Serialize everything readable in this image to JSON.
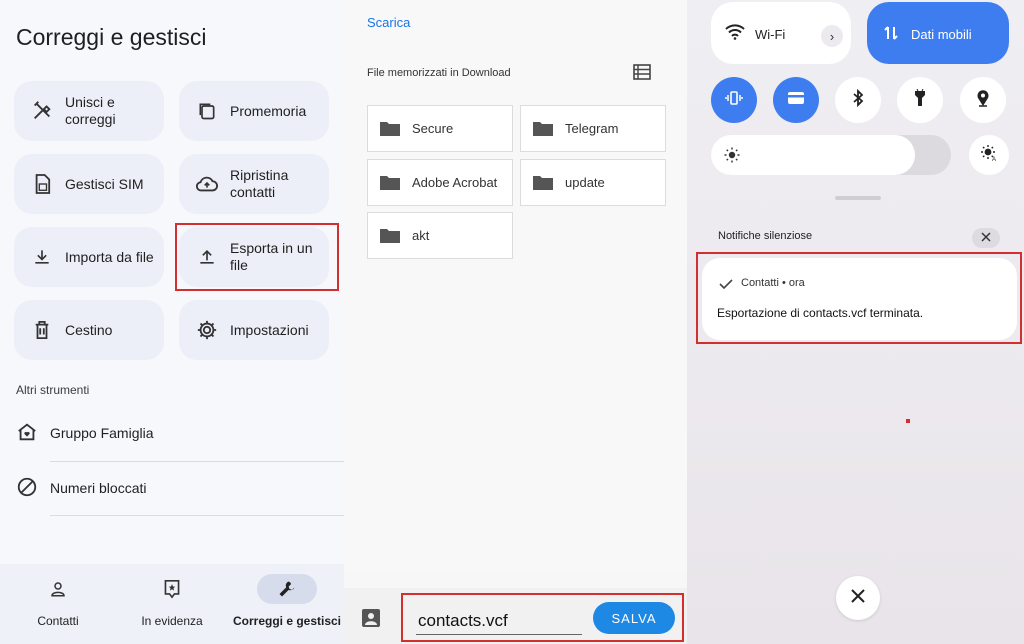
{
  "colors": {
    "highlight": "#d32f2f",
    "accent_blue": "#3e7df0",
    "link_blue": "#1a73e8",
    "save_blue": "#1e88e5"
  },
  "panel1": {
    "title": "Correggi e gestisci",
    "tiles": [
      {
        "label": "Unisci e correggi",
        "icon": "merge-tools-icon"
      },
      {
        "label": "Promemoria",
        "icon": "reminder-icon"
      },
      {
        "label": "Gestisci SIM",
        "icon": "sim-card-icon"
      },
      {
        "label": "Ripristina contatti",
        "icon": "cloud-restore-icon"
      },
      {
        "label": "Importa da file",
        "icon": "download-icon"
      },
      {
        "label": "Esporta in un file",
        "icon": "upload-icon"
      },
      {
        "label": "Cestino",
        "icon": "trash-icon"
      },
      {
        "label": "Impostazioni",
        "icon": "gear-icon"
      }
    ],
    "section_label": "Altri strumenti",
    "list": [
      {
        "label": "Gruppo Famiglia",
        "icon": "family-home-icon"
      },
      {
        "label": "Numeri bloccati",
        "icon": "block-icon"
      }
    ],
    "nav": [
      {
        "label": "Contatti",
        "icon": "person-icon"
      },
      {
        "label": "In evidenza",
        "icon": "highlights-icon"
      },
      {
        "label": "Correggi e gestisci",
        "icon": "wrench-icon",
        "active": true
      }
    ]
  },
  "panel2": {
    "breadcrumb": "Scarica",
    "subheading": "File memorizzati in Download",
    "folders": [
      "Secure",
      "Telegram",
      "Adobe Acrobat",
      "update",
      "akt"
    ],
    "filename": "contacts.vcf",
    "save_label": "SALVA"
  },
  "panel3": {
    "wifi_label": "Wi-Fi",
    "chevron": "›",
    "mobile_data_label": "Dati mobili",
    "brightness_level": 0.85,
    "notifications_header": "Notifiche silenziose",
    "notification": {
      "app": "Contatti • ora",
      "body": "Esportazione di contacts.vcf terminata."
    }
  }
}
